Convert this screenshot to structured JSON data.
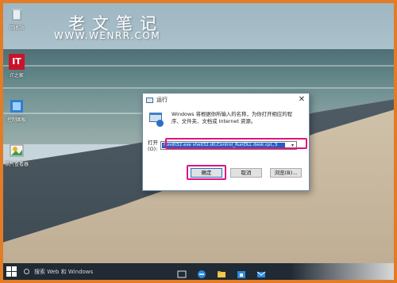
{
  "watermark": {
    "chinese": "老文笔记",
    "url": "WWW.WENRR.COM"
  },
  "desktop_icons": [
    {
      "name": "recycle-bin",
      "label": "回收站",
      "icon": "recycle-bin-icon"
    },
    {
      "name": "it",
      "label": "IT之家",
      "icon": "it-home-icon"
    },
    {
      "name": "control",
      "label": "控制面板",
      "icon": "control-panel-icon"
    },
    {
      "name": "photos",
      "label": "照片查看器",
      "icon": "photo-viewer-icon"
    }
  ],
  "run_dialog": {
    "title": "运行",
    "close_glyph": "✕",
    "description": "Windows 将根据你所输入的名称，为你打开相应的程序、文件夹、文档或 Internet 资源。",
    "open_label": "打开(O):",
    "command_value": "rundll32.exe shell32.dll,Control_RunDLL desk.cpl,,3",
    "dropdown_glyph": "▾",
    "buttons": {
      "ok": "确定",
      "cancel": "取消",
      "browse": "浏览(B)..."
    }
  },
  "taskbar": {
    "search_text": "搜索 Web 和 Windows",
    "pinned": [
      "task-view-icon",
      "ie-icon",
      "file-explorer-icon",
      "store-icon",
      "mail-icon"
    ]
  },
  "colors": {
    "highlight": "#e0147a",
    "selection": "#1f5fc7",
    "frame": "#e27c26",
    "taskbar": "#1f2a34"
  }
}
